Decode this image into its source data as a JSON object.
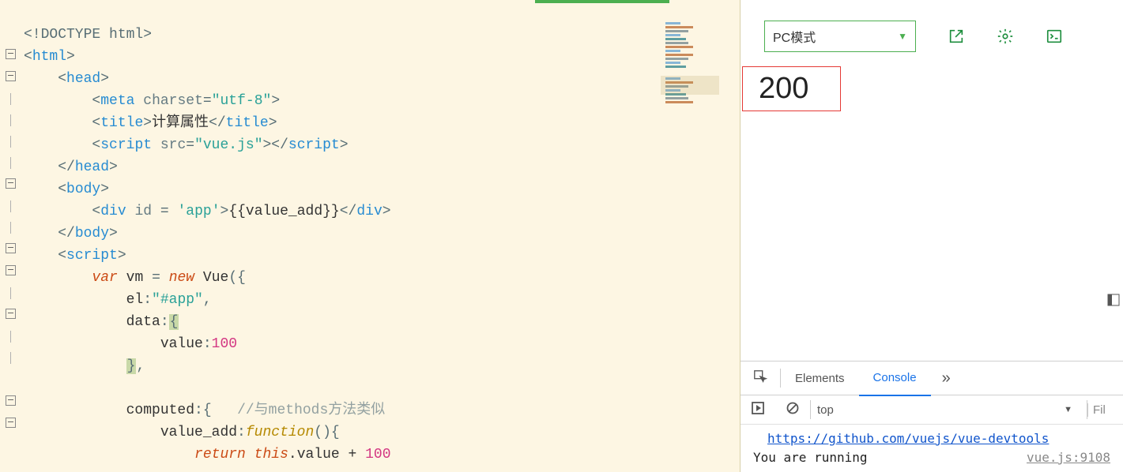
{
  "code": {
    "doctype": "<!DOCTYPE html>",
    "html_open": "html",
    "head_open": "head",
    "meta_tag": "meta",
    "meta_attr": "charset",
    "meta_val": "\"utf-8\"",
    "title_tag": "title",
    "title_text": "计算属性",
    "script_tag": "script",
    "script_attr": "src",
    "script_val": "\"vue.js\"",
    "head_close": "head",
    "body_open": "body",
    "div_tag": "div",
    "div_attr": "id",
    "div_val": "'app'",
    "div_text": "{{value_add}}",
    "body_close": "body",
    "var_kw": "var",
    "vm": "vm",
    "eq": "=",
    "new_kw": "new",
    "vue_ctor": "Vue",
    "el_key": "el",
    "el_val": "\"#app\"",
    "data_key": "data",
    "value_key": "value",
    "value_num": "100",
    "computed_key": "computed",
    "computed_comment": "//与methods方法类似",
    "value_add_key": "value_add",
    "function_kw": "function",
    "return_kw": "return",
    "this_kw": "this",
    "dot_value": ".value",
    "plus": " + ",
    "plus_num": "100"
  },
  "toolbar": {
    "mode_label": "PC模式"
  },
  "output": {
    "value": "200"
  },
  "devtools": {
    "tabs": {
      "elements": "Elements",
      "console": "Console"
    },
    "scope": "top",
    "filter_placeholder": "Fil",
    "log_link": "https://github.com/vuejs/vue-devtools",
    "log_running": "You are running",
    "log_src": "vue.js:9108"
  }
}
